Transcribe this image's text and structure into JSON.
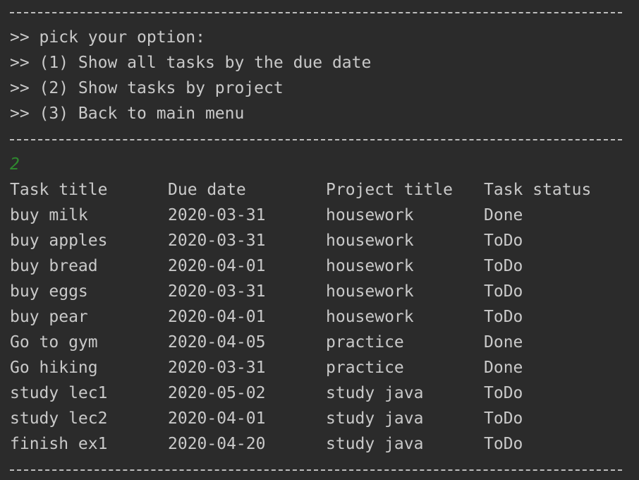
{
  "menu": {
    "prompt": ">> pick your option:",
    "options": [
      ">> (1) Show all tasks by the due date",
      ">> (2) Show tasks by project",
      ">> (3) Back to main menu"
    ]
  },
  "user_input": "2",
  "table": {
    "headers": [
      "Task title",
      "Due date",
      "Project title",
      "Task status"
    ],
    "rows": [
      [
        "buy milk",
        "2020-03-31",
        "housework",
        "Done"
      ],
      [
        "buy apples",
        "2020-03-31",
        "housework",
        "ToDo"
      ],
      [
        "buy bread",
        "2020-04-01",
        "housework",
        "ToDo"
      ],
      [
        "buy eggs",
        "2020-03-31",
        "housework",
        "ToDo"
      ],
      [
        "buy pear",
        "2020-04-01",
        "housework",
        "ToDo"
      ],
      [
        "Go to gym",
        "2020-04-05",
        "practice",
        "Done"
      ],
      [
        "Go hiking",
        "2020-03-31",
        "practice",
        "Done"
      ],
      [
        "study lec1",
        "2020-05-02",
        "study java",
        "ToDo"
      ],
      [
        "study lec2",
        "2020-04-01",
        "study java",
        "ToDo"
      ],
      [
        "finish ex1",
        "2020-04-20",
        "study java",
        "ToDo"
      ]
    ]
  },
  "colors": {
    "background": "#2b2b2b",
    "text": "#c9c9c9",
    "input_echo": "#2f8a2f"
  }
}
